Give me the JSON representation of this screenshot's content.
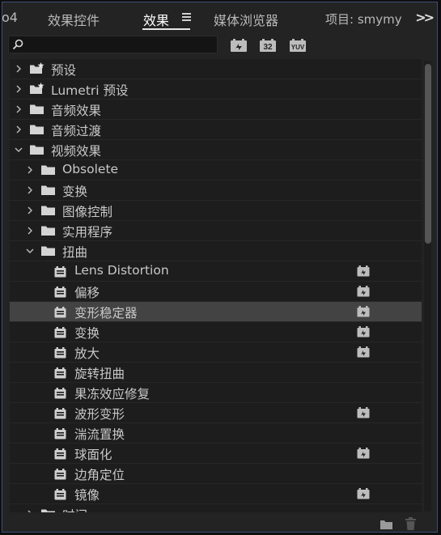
{
  "tabs": {
    "partial_left": "o4",
    "effect_controls": "效果控件",
    "effects": "效果",
    "media_browser": "媒体浏览器",
    "project": "项目: smymy"
  },
  "search": {
    "value": "",
    "placeholder": ""
  },
  "filters": {
    "accelerated": "加速效果",
    "bit32": "32",
    "yuv": "YUV"
  },
  "tree": [
    {
      "label": "预设",
      "level": 0,
      "type": "preset-folder",
      "expanded": false
    },
    {
      "label": "Lumetri 预设",
      "level": 0,
      "type": "preset-folder",
      "expanded": false
    },
    {
      "label": "音频效果",
      "level": 0,
      "type": "folder",
      "expanded": false
    },
    {
      "label": "音频过渡",
      "level": 0,
      "type": "folder",
      "expanded": false
    },
    {
      "label": "视频效果",
      "level": 0,
      "type": "folder",
      "expanded": true
    },
    {
      "label": "Obsolete",
      "level": 1,
      "type": "folder",
      "expanded": false
    },
    {
      "label": "变换",
      "level": 1,
      "type": "folder",
      "expanded": false
    },
    {
      "label": "图像控制",
      "level": 1,
      "type": "folder",
      "expanded": false
    },
    {
      "label": "实用程序",
      "level": 1,
      "type": "folder",
      "expanded": false
    },
    {
      "label": "扭曲",
      "level": 1,
      "type": "folder",
      "expanded": true
    },
    {
      "label": "Lens Distortion",
      "level": 2,
      "type": "effect",
      "accelerated": true
    },
    {
      "label": "偏移",
      "level": 2,
      "type": "effect",
      "accelerated": true
    },
    {
      "label": "变形稳定器",
      "level": 2,
      "type": "effect",
      "accelerated": true,
      "selected": true
    },
    {
      "label": "变换",
      "level": 2,
      "type": "effect",
      "accelerated": true
    },
    {
      "label": "放大",
      "level": 2,
      "type": "effect",
      "accelerated": true
    },
    {
      "label": "旋转扭曲",
      "level": 2,
      "type": "effect",
      "accelerated": false
    },
    {
      "label": "果冻效应修复",
      "level": 2,
      "type": "effect",
      "accelerated": false
    },
    {
      "label": "波形变形",
      "level": 2,
      "type": "effect",
      "accelerated": true
    },
    {
      "label": "湍流置换",
      "level": 2,
      "type": "effect",
      "accelerated": false
    },
    {
      "label": "球面化",
      "level": 2,
      "type": "effect",
      "accelerated": true
    },
    {
      "label": "边角定位",
      "level": 2,
      "type": "effect",
      "accelerated": false
    },
    {
      "label": "镜像",
      "level": 2,
      "type": "effect",
      "accelerated": true
    },
    {
      "label": "时间",
      "level": 1,
      "type": "folder",
      "expanded": false
    }
  ],
  "scroll_position": 0.0,
  "bottom_bar": {
    "new_bin_icon": "folder-icon",
    "delete_icon": "trash-icon"
  },
  "colors": {
    "accent": "#3c4f77",
    "selected_row": "#434343",
    "panel_bg": "#1d1d1d"
  }
}
